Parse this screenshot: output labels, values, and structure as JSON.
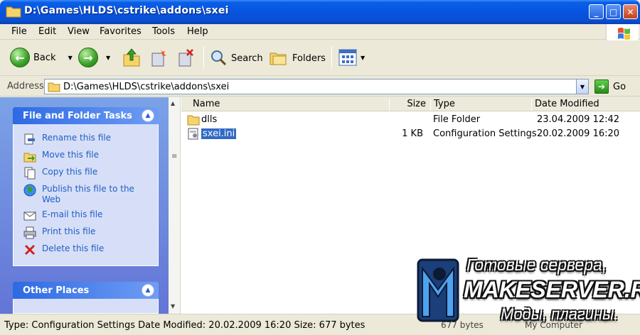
{
  "window": {
    "title": "D:\\Games\\HLDS\\cstrike\\addons\\sxei",
    "minimize_label": "_",
    "maximize_label": "□",
    "close_label": "✕"
  },
  "menu": [
    "File",
    "Edit",
    "View",
    "Favorites",
    "Tools",
    "Help"
  ],
  "toolbar": {
    "back_label": "Back",
    "search_label": "Search",
    "folders_label": "Folders"
  },
  "address": {
    "label": "Address",
    "value": "D:\\Games\\HLDS\\cstrike\\addons\\sxei",
    "go_label": "Go"
  },
  "task_pane": {
    "file_tasks": {
      "title": "File and Folder Tasks",
      "items": [
        {
          "label": "Rename this file",
          "icon": "rename-icon"
        },
        {
          "label": "Move this file",
          "icon": "move-icon"
        },
        {
          "label": "Copy this file",
          "icon": "copy-icon"
        },
        {
          "label": "Publish this file to the Web",
          "icon": "globe-icon"
        },
        {
          "label": "E-mail this file",
          "icon": "email-icon"
        },
        {
          "label": "Print this file",
          "icon": "printer-icon"
        },
        {
          "label": "Delete this file",
          "icon": "delete-icon"
        }
      ]
    },
    "other_places": {
      "title": "Other Places"
    }
  },
  "file_list": {
    "columns": {
      "name": "Name",
      "size": "Size",
      "type": "Type",
      "modified": "Date Modified"
    },
    "rows": [
      {
        "name": "dlls",
        "size": "",
        "type": "File Folder",
        "modified": "23.04.2009 12:42",
        "icon": "folder-icon"
      },
      {
        "name": "sxei.ini",
        "size": "1 KB",
        "type": "Configuration Settings",
        "modified": "20.02.2009 16:20",
        "icon": "ini-file-icon",
        "selected": true
      }
    ]
  },
  "status": {
    "text": "Type: Configuration Settings Date Modified: 20.02.2009 16:20 Size: 677 bytes",
    "size": "677 bytes",
    "zone": "My Computer"
  },
  "watermark": {
    "line1": "Готовые сервера,",
    "line2": "MAKESERVER.RU",
    "line3": "Моды, плагины."
  },
  "colors": {
    "titlebar": "#0754e0",
    "task_link": "#215dc6",
    "selection": "#316ac5"
  }
}
